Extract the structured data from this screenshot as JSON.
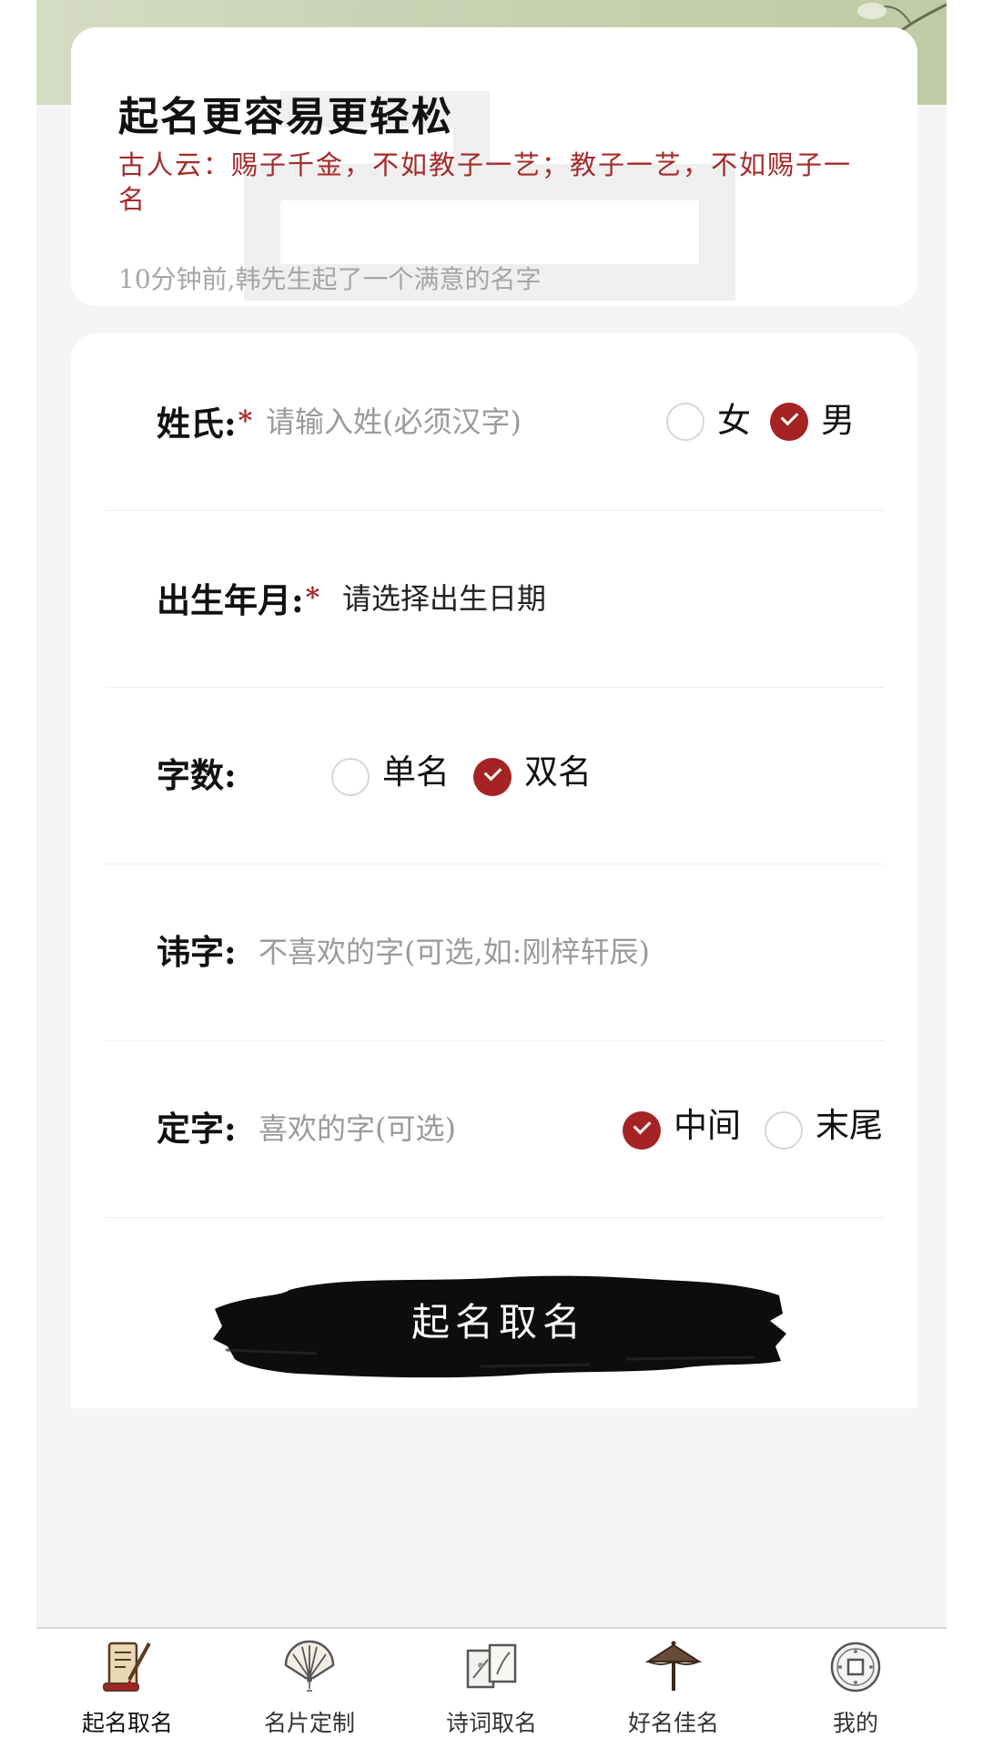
{
  "intro": {
    "title": "起名更容易更轻松",
    "quote": "古人云：赐子千金，不如教子一艺；教子一艺，不如赐子一名",
    "recent": "10分钟前,韩先生起了一个满意的名字"
  },
  "form": {
    "surname": {
      "label": "姓氏:",
      "required": "*",
      "placeholder": "请输入姓(必须汉字)",
      "gender_options": [
        {
          "label": "女",
          "checked": false
        },
        {
          "label": "男",
          "checked": true
        }
      ]
    },
    "birth": {
      "label": "出生年月:",
      "required": "*",
      "value": "请选择出生日期"
    },
    "count": {
      "label": "字数:",
      "options": [
        {
          "label": "单名",
          "checked": false
        },
        {
          "label": "双名",
          "checked": true
        }
      ]
    },
    "avoid": {
      "label": "讳字:",
      "placeholder": "不喜欢的字(可选,如:刚梓轩辰)"
    },
    "fixed": {
      "label": "定字:",
      "placeholder": "喜欢的字(可选)",
      "options": [
        {
          "label": "中间",
          "checked": true
        },
        {
          "label": "末尾",
          "checked": false
        }
      ]
    },
    "submit_label": "起名取名"
  },
  "tabbar": {
    "items": [
      {
        "label": "起名取名",
        "icon": "scroll-brush-icon",
        "active": true
      },
      {
        "label": "名片定制",
        "icon": "fan-icon",
        "active": false
      },
      {
        "label": "诗词取名",
        "icon": "poetry-scroll-icon",
        "active": false
      },
      {
        "label": "好名佳名",
        "icon": "umbrella-icon",
        "active": false
      },
      {
        "label": "我的",
        "icon": "coin-icon",
        "active": false
      }
    ]
  },
  "colors": {
    "accent": "#a52323",
    "quote": "#a52a2a",
    "background": "#f5f5f5"
  }
}
